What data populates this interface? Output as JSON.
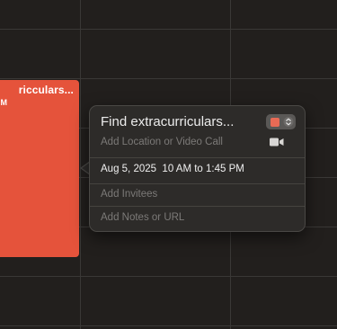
{
  "event_block": {
    "title": "ricculars...",
    "time": "M",
    "color": "#e5533b"
  },
  "popover": {
    "title": "Find extracurriculars...",
    "calendar_color": "#e86a55",
    "location_placeholder": "Add Location or Video Call",
    "video_icon": "video-camera-icon",
    "date": "Aug 5, 2025",
    "time_range": "10 AM to 1:45 PM",
    "invitees_placeholder": "Add Invitees",
    "notes_placeholder": "Add Notes or URL"
  }
}
